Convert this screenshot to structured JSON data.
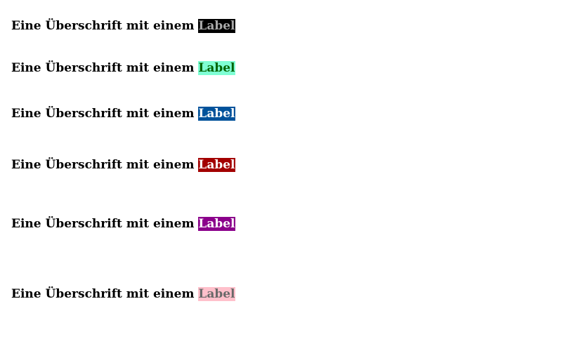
{
  "headings": [
    {
      "text": "Eine Überschrift mit einem",
      "label": "Label",
      "label_bg": "#000000",
      "label_fg": "#a9a9a9"
    },
    {
      "text": "Eine Überschrift mit einem",
      "label": "Label",
      "label_bg": "#7fffd4",
      "label_fg": "#006400"
    },
    {
      "text": "Eine Überschrift mit einem",
      "label": "Label",
      "label_bg": "#00529b",
      "label_fg": "#ffffff"
    },
    {
      "text": "Eine Überschrift mit einem",
      "label": "Label",
      "label_bg": "#a30000",
      "label_fg": "#ffffff"
    },
    {
      "text": "Eine Überschrift mit einem",
      "label": "Label",
      "label_bg": "#8b008b",
      "label_fg": "#ffffff"
    },
    {
      "text": "Eine Überschrift mit einem",
      "label": "Label",
      "label_bg": "#ffc0cb",
      "label_fg": "#696969"
    }
  ]
}
